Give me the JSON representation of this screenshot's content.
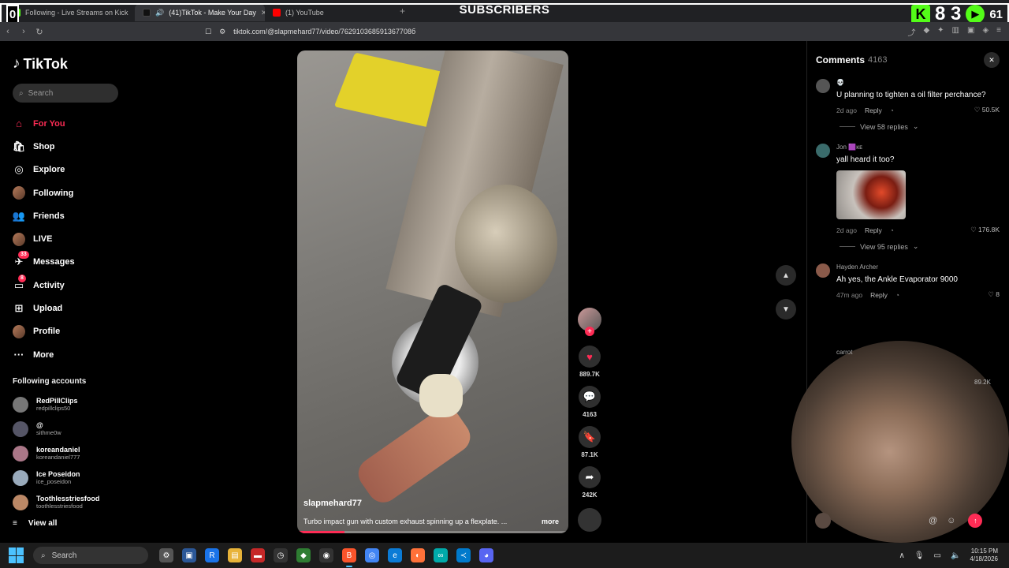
{
  "overlay": {
    "title": "SUBSCRIBERS",
    "left_count": "0",
    "right_count": "8 3",
    "right_small": "61"
  },
  "tabs": [
    {
      "label": "Following - Live Streams on Kick",
      "color": "#53fc18",
      "active": false
    },
    {
      "label": "(41)TikTok - Make Your Day",
      "color": "#111111",
      "active": true
    },
    {
      "label": "(1) YouTube",
      "color": "#ff0000",
      "active": false
    }
  ],
  "address": {
    "url": "tiktok.com/@slapmehard77/video/762910368591367708б"
  },
  "sidebar": {
    "brand": "TikTok",
    "search_placeholder": "Search",
    "nav": [
      {
        "label": "For You",
        "icon": "home-icon",
        "glyph": "⌂",
        "active": true
      },
      {
        "label": "Shop",
        "icon": "shop-icon",
        "glyph": "🛍"
      },
      {
        "label": "Explore",
        "icon": "compass-icon",
        "glyph": "◎"
      },
      {
        "label": "Following",
        "icon": "following-avatar",
        "glyph": "",
        "avatar": true
      },
      {
        "label": "Friends",
        "icon": "friends-icon",
        "glyph": "👥"
      },
      {
        "label": "LIVE",
        "icon": "live-avatar",
        "glyph": "",
        "avatar": true
      },
      {
        "label": "Messages",
        "icon": "messages-icon",
        "glyph": "✈",
        "badge": "33"
      },
      {
        "label": "Activity",
        "icon": "activity-icon",
        "glyph": "▭",
        "badge": "8"
      },
      {
        "label": "Upload",
        "icon": "upload-icon",
        "glyph": "⊞"
      },
      {
        "label": "Profile",
        "icon": "profile-avatar",
        "glyph": "",
        "avatar": true
      },
      {
        "label": "More",
        "icon": "more-icon",
        "glyph": "···"
      }
    ],
    "following_title": "Following accounts",
    "accounts": [
      {
        "name": "RedPillClips",
        "handle": "redpillclips50"
      },
      {
        "name": "@",
        "handle": "sithme0w"
      },
      {
        "name": "koreandaniel",
        "handle": "koreandaniel777"
      },
      {
        "name": "Ice Poseidon",
        "handle": "ice_poseidon"
      },
      {
        "name": "Toothlesstriesfood",
        "handle": "toothlesstriesfood"
      }
    ],
    "view_all": "View all"
  },
  "video": {
    "username": "slapmehard77",
    "caption": "Turbo impact gun with custom exhaust spinning up a flexplate. ...",
    "more": "more"
  },
  "rail": {
    "likes": "889.7K",
    "comments": "4163",
    "saves": "87.1K",
    "shares": "242K"
  },
  "comments": {
    "title": "Comments",
    "count": "4163",
    "items": [
      {
        "user": "💀",
        "text": "U planning to tighten a oil filter perchance?",
        "time": "2d ago",
        "reply": "Reply",
        "likes": "50.5K",
        "replies": "View 58 replies"
      },
      {
        "user": "Jon 🟪ᴋᴇ",
        "text": "yall heard it too?",
        "time": "2d ago",
        "reply": "Reply",
        "likes": "176.8K",
        "replies": "View 95 replies",
        "image": true
      },
      {
        "user": "Hayden Archer",
        "text": "Ah yes, the Ankle Evaporator 9000",
        "time": "47m ago",
        "reply": "Reply",
        "likes": "8"
      }
    ],
    "partial_user": "carrot",
    "partial_likes": "89.2K"
  },
  "taskbar": {
    "search": "Search",
    "time": "10:15 PM",
    "date": "4/18/2026"
  }
}
